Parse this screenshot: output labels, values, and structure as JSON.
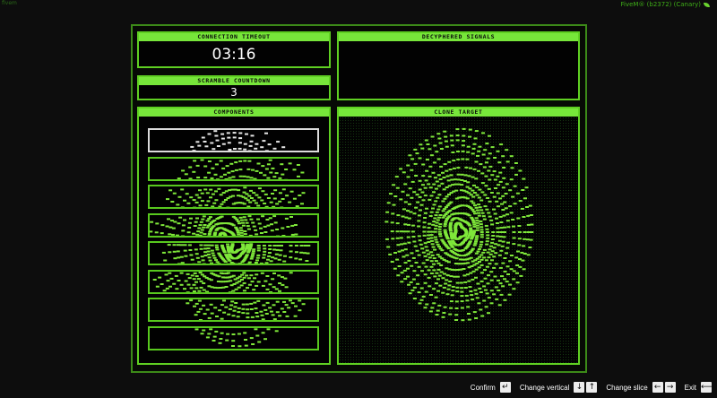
{
  "app": {
    "top_left": "fivem",
    "build": "FiveM® (b2372) (Canary)"
  },
  "panels": {
    "timeout": {
      "title": "CONNECTION TIMEOUT",
      "value": "03:16"
    },
    "scramble": {
      "title": "SCRAMBLE COUNTDOWN",
      "value": "3"
    },
    "signals": {
      "title": "DECYPHERED SIGNALS"
    },
    "components": {
      "title": "COMPONENTS",
      "selected_index": 0,
      "slice_count": 8
    },
    "clone": {
      "title": "CLONE TARGET"
    }
  },
  "hints": [
    {
      "label": "Confirm",
      "keys": [
        "↵"
      ]
    },
    {
      "label": "Change vertical",
      "keys": [
        "↓",
        "↑"
      ]
    },
    {
      "label": "Change slice",
      "keys": [
        "←",
        "→"
      ]
    },
    {
      "label": "Exit",
      "keys": [
        "⟵"
      ]
    }
  ],
  "colors": {
    "accent": "#77e63a",
    "frame": "#3c8a18",
    "fingerprint": "#7fe83a",
    "selected_slice": "#dcdcdc"
  }
}
